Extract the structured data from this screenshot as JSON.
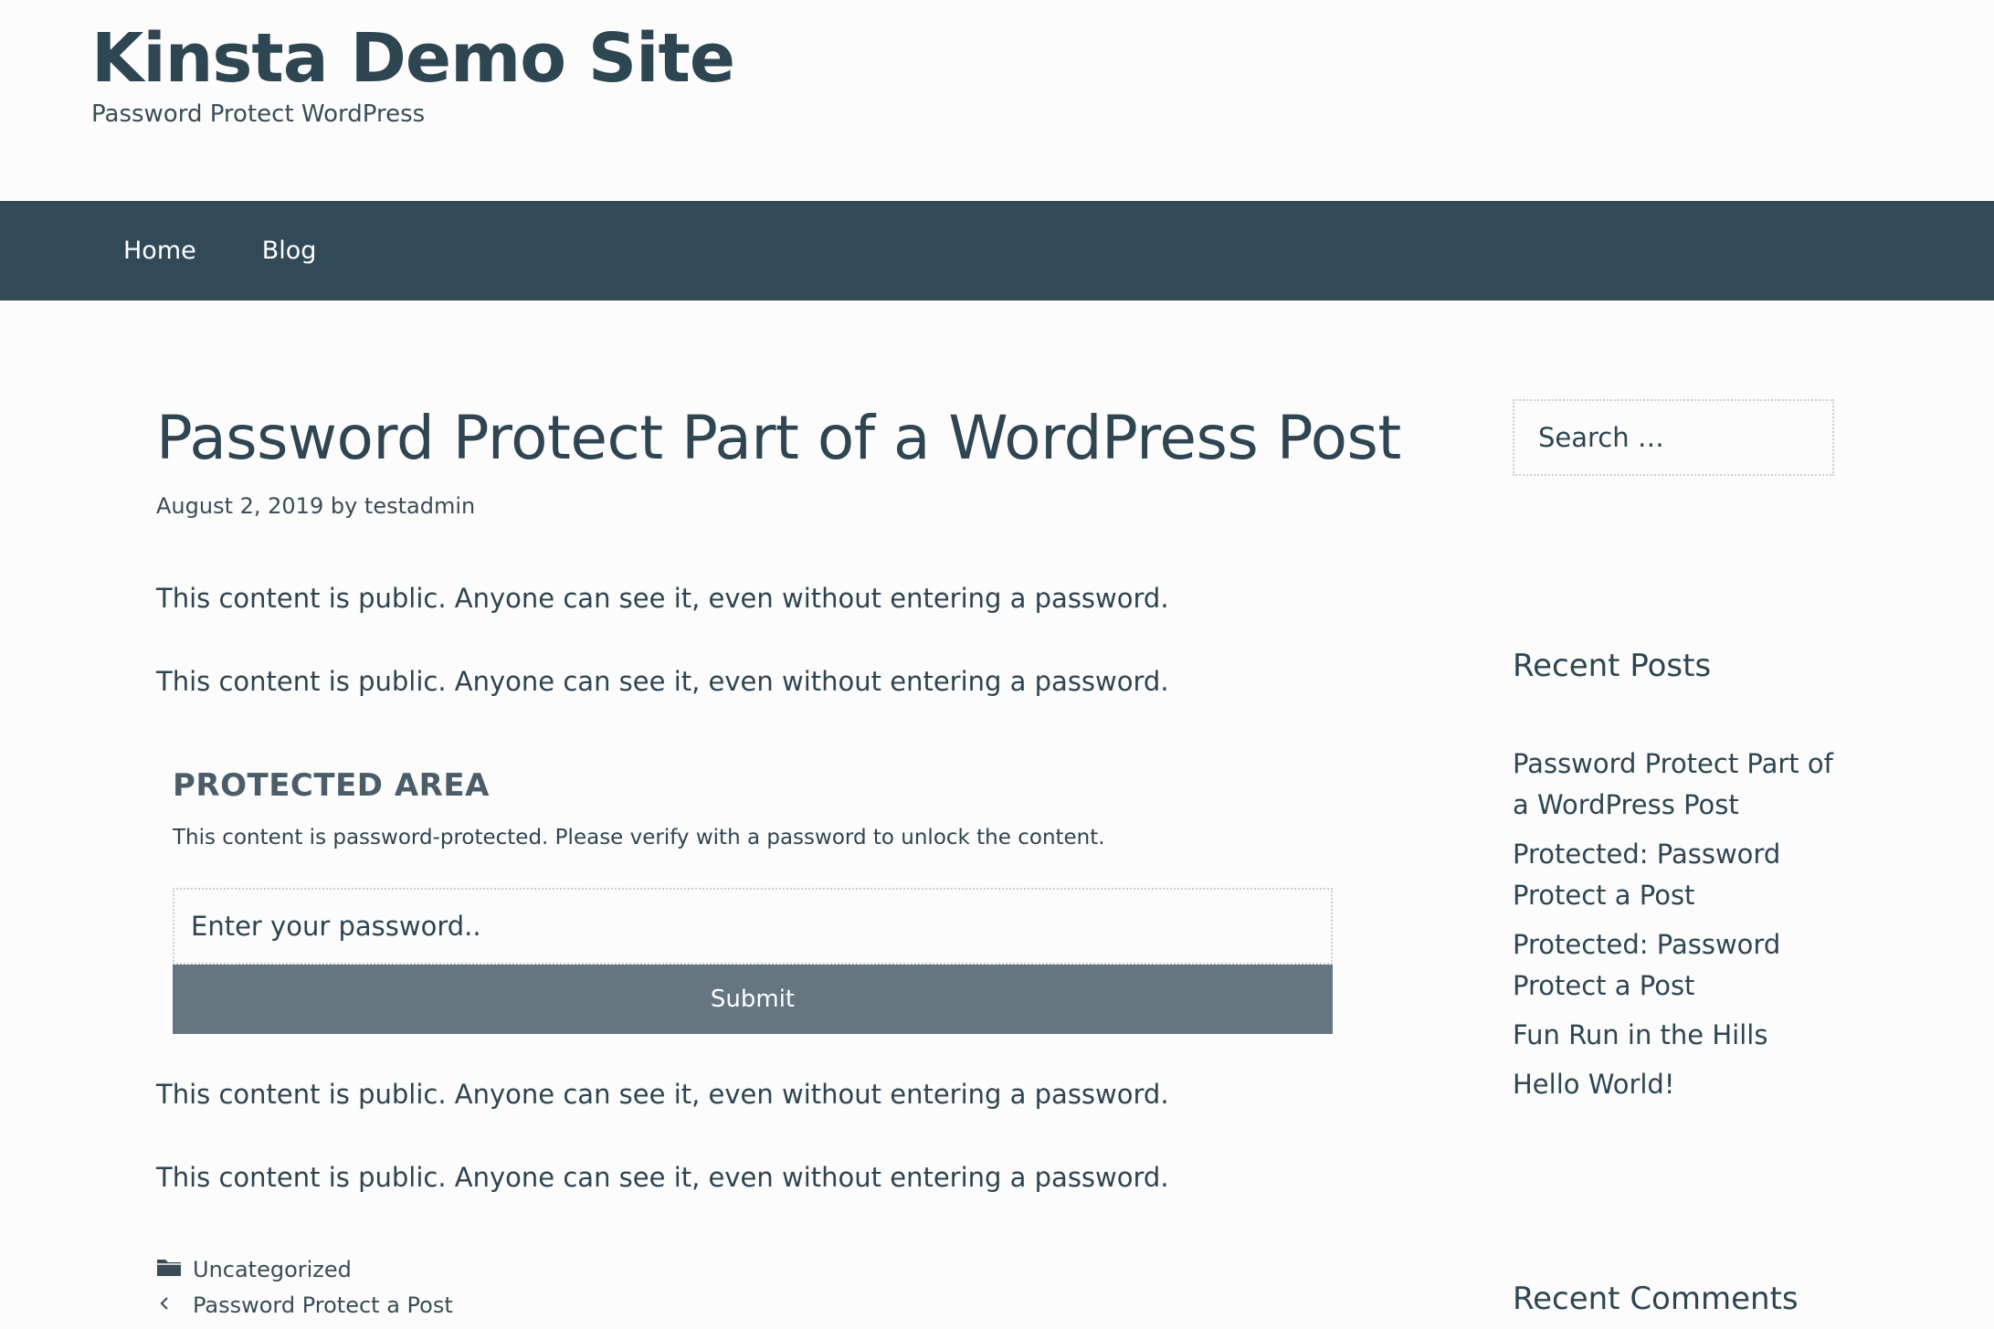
{
  "header": {
    "site_title": "Kinsta Demo Site",
    "tagline": "Password Protect WordPress"
  },
  "nav": {
    "items": [
      {
        "label": "Home"
      },
      {
        "label": "Blog"
      }
    ]
  },
  "post": {
    "title": "Password Protect Part of a WordPress Post",
    "meta": "August 2, 2019 by testadmin",
    "paragraphs": [
      "This content is public. Anyone can see it, even without entering a password.",
      "This content is public. Anyone can see it, even without entering a password.",
      "This content is public. Anyone can see it, even without entering a password.",
      "This content is public. Anyone can see it, even without entering a password."
    ],
    "protected": {
      "heading": "PROTECTED AREA",
      "description": "This content is password-protected. Please verify with a password to unlock the content.",
      "password_placeholder": "Enter your password..",
      "submit_label": "Submit"
    },
    "footer": {
      "category": "Uncategorized",
      "prev_post": "Password Protect a Post",
      "category_icon": "folder-icon",
      "prev_icon": "chevron-left-icon"
    }
  },
  "sidebar": {
    "search_placeholder": "Search …",
    "recent_posts_title": "Recent Posts",
    "recent_posts": [
      "Password Protect Part of a WordPress Post",
      "Protected: Password Protect a Post",
      "Protected: Password Protect a Post",
      "Fun Run in the Hills",
      "Hello World!"
    ],
    "recent_comments_title": "Recent Comments"
  },
  "colors": {
    "nav_background": "#324a58",
    "submit_background": "#657681",
    "text": "#2e4450",
    "page_background": "#fcfcfc"
  }
}
